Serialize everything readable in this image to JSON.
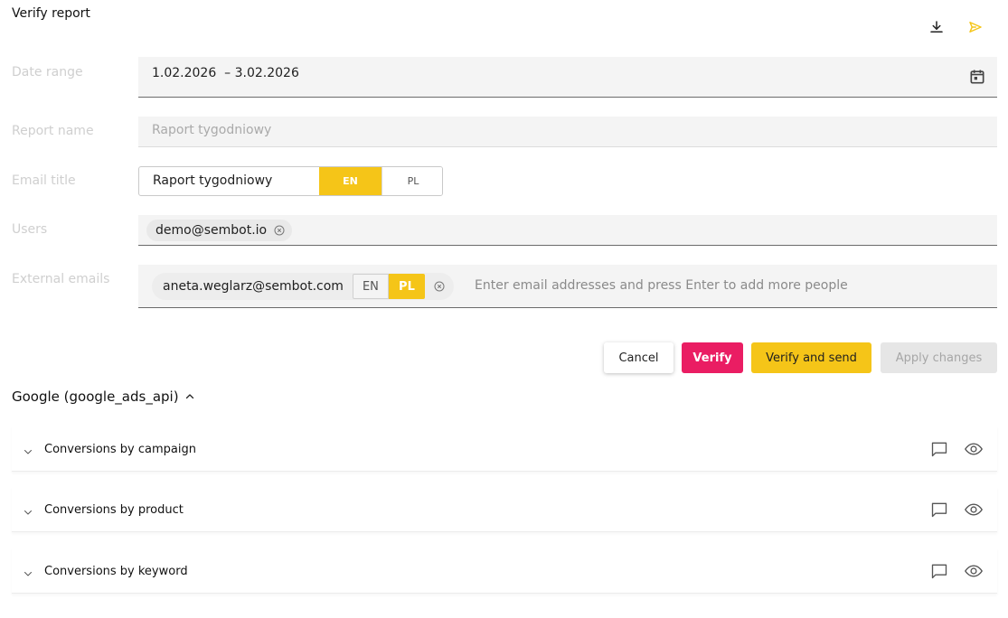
{
  "page": {
    "title": "Verify report"
  },
  "form": {
    "date_range": {
      "label": "Date range",
      "value": "1.02.2026  – 3.02.2026"
    },
    "report_name": {
      "label": "Report name",
      "placeholder": "Raport tygodniowy"
    },
    "email_title": {
      "label": "Email title",
      "value": "Raport tygodniowy",
      "languages": [
        "EN",
        "PL"
      ],
      "selected_language": "EN"
    },
    "users": {
      "label": "Users",
      "chips": [
        "demo@sembot.io"
      ]
    },
    "external_emails": {
      "label": "External emails",
      "chips": [
        {
          "email": "aneta.weglarz@sembot.com",
          "languages": [
            "EN",
            "PL"
          ],
          "selected_language": "PL"
        }
      ],
      "placeholder": "Enter email addresses and press Enter to add more people"
    }
  },
  "actions": {
    "cancel": "Cancel",
    "verify": "Verify",
    "verify_and_send": "Verify and send",
    "apply_changes": "Apply changes"
  },
  "section": {
    "title": "Google (google_ads_api)",
    "panels": [
      {
        "label": "Conversions by campaign"
      },
      {
        "label": "Conversions by product"
      },
      {
        "label": "Conversions by keyword"
      }
    ]
  },
  "icons": {
    "download": "download-icon",
    "send": "send-icon",
    "calendar": "calendar-icon",
    "comment": "comment-icon",
    "eye": "eye-icon"
  },
  "colors": {
    "accent_yellow": "#f5c518",
    "verify_pink": "#ea1d63",
    "disabled_gray": "#e6e6e6"
  }
}
